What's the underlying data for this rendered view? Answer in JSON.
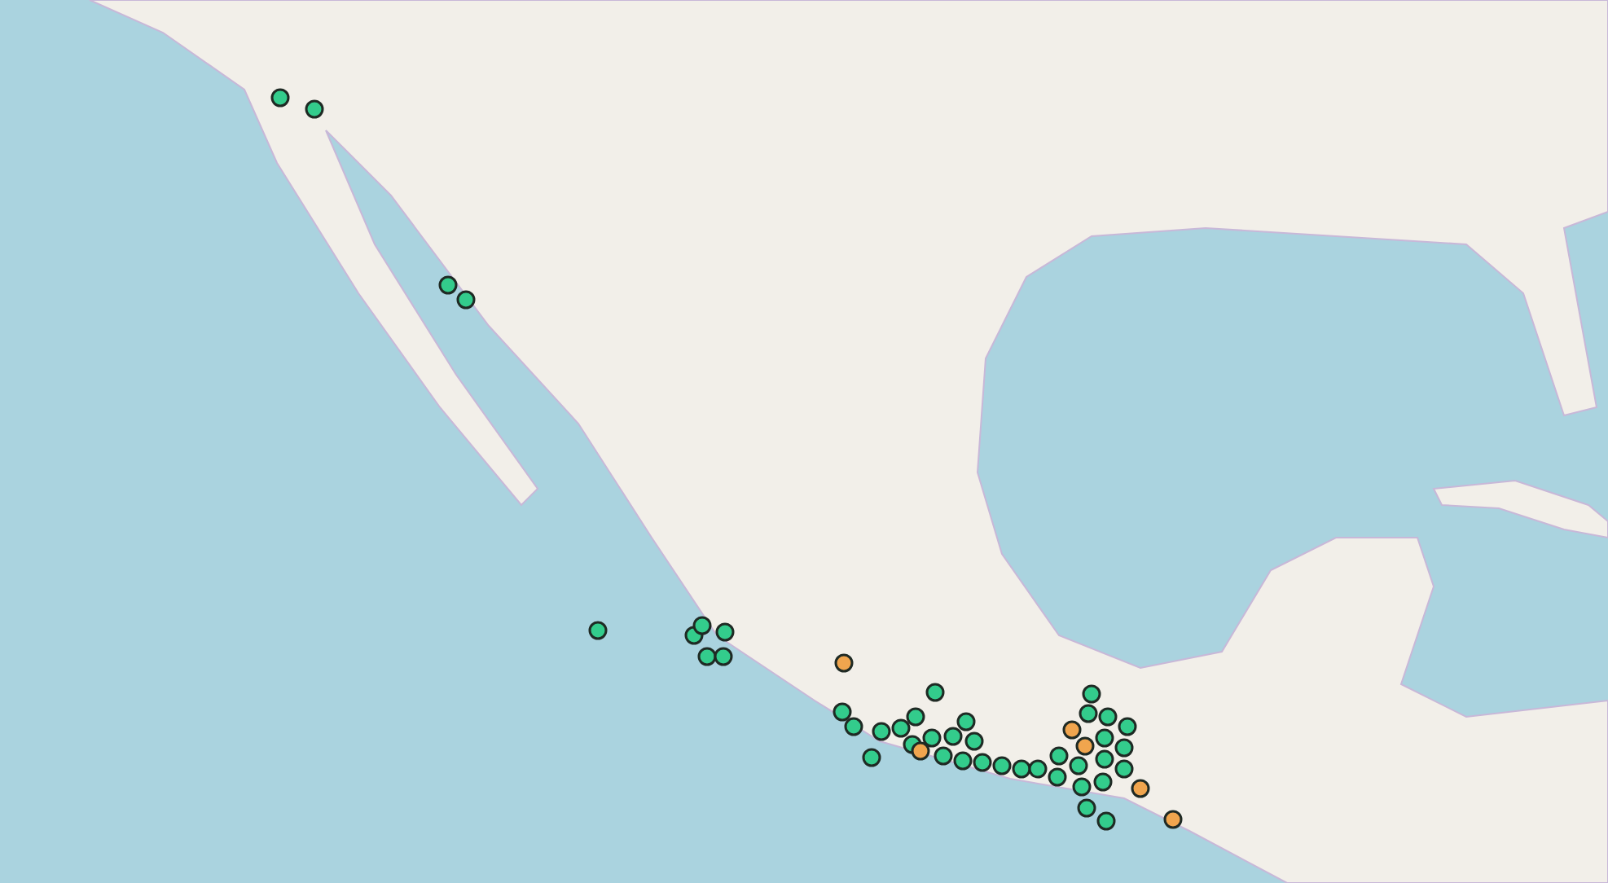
{
  "map": {
    "markers": [
      {
        "color": "#33cc8c"
      },
      {
        "color": "#33cc8c"
      },
      {
        "color": "#33cc8c"
      },
      {
        "color": "#33cc8c"
      },
      {
        "color": "#33cc8c"
      },
      {
        "color": "#33cc8c"
      },
      {
        "color": "#33cc8c"
      },
      {
        "color": "#33cc8c"
      },
      {
        "color": "#33cc8c"
      },
      {
        "color": "#33cc8c"
      },
      {
        "color": "#33cc8c"
      },
      {
        "color": "#33cc8c"
      },
      {
        "color": "#33cc8c"
      },
      {
        "color": "#33cc8c"
      },
      {
        "color": "#33cc8c"
      },
      {
        "color": "#33cc8c"
      },
      {
        "color": "#33cc8c"
      },
      {
        "color": "#33cc8c"
      },
      {
        "color": "#33cc8c"
      },
      {
        "color": "#33cc8c"
      },
      {
        "color": "#33cc8c"
      },
      {
        "color": "#33cc8c"
      },
      {
        "color": "#33cc8c"
      },
      {
        "color": "#33cc8c"
      },
      {
        "color": "#33cc8c"
      },
      {
        "color": "#33cc8c"
      },
      {
        "color": "#33cc8c"
      },
      {
        "color": "#33cc8c"
      },
      {
        "color": "#33cc8c"
      },
      {
        "color": "#33cc8c"
      },
      {
        "color": "#33cc8c"
      },
      {
        "color": "#33cc8c"
      },
      {
        "color": "#33cc8c"
      },
      {
        "color": "#33cc8c"
      },
      {
        "color": "#33cc8c"
      },
      {
        "color": "#33cc8c"
      },
      {
        "color": "#33cc8c"
      },
      {
        "color": "#33cc8c"
      },
      {
        "color": "#33cc8c"
      },
      {
        "color": "#33cc8c"
      },
      {
        "color": "#33cc8c"
      },
      {
        "color": "#33cc8c"
      },
      {
        "color": "#33cc8c"
      },
      {
        "color": "#f0a54e"
      },
      {
        "color": "#f0a54e"
      },
      {
        "color": "#f0a54e"
      },
      {
        "color": "#f0a54e"
      },
      {
        "color": "#f0a54e"
      },
      {
        "color": "#f0a54e"
      }
    ]
  }
}
